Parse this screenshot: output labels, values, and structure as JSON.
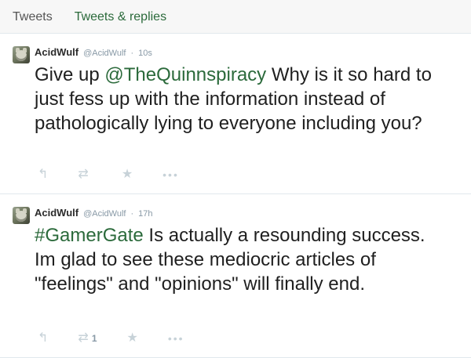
{
  "tabs": {
    "tweets": "Tweets",
    "replies": "Tweets & replies"
  },
  "tweets": [
    {
      "name": "AcidWulf",
      "handle": "@AcidWulf",
      "separator": "·",
      "time": "10s",
      "text": {
        "before": "Give up ",
        "mention": "@TheQuinnspiracy",
        "after": " Why is it so hard to just fess up with the information instead of pathologically lying to everyone including you?"
      },
      "actions": {
        "retweet_count": "",
        "reply_icon": "reply-icon",
        "retweet_icon": "retweet-icon",
        "favorite_icon": "favorite-icon",
        "more_icon": "more-icon"
      }
    },
    {
      "name": "AcidWulf",
      "handle": "@AcidWulf",
      "separator": "·",
      "time": "17h",
      "text": {
        "hashtag": "#GamerGate",
        "after": " Is actually a resounding success. Im glad to see these mediocric articles of \"feelings\" and \"opinions\" will finally end."
      },
      "actions": {
        "retweet_count": "1",
        "reply_icon": "reply-icon",
        "retweet_icon": "retweet-icon",
        "favorite_icon": "favorite-icon",
        "more_icon": "more-icon"
      }
    }
  ],
  "colors": {
    "accent_green": "#2b6a3b",
    "text": "#1f1f1f",
    "meta": "#8899a6",
    "icon": "#c7d2d8",
    "divider": "#e1e8ed"
  }
}
